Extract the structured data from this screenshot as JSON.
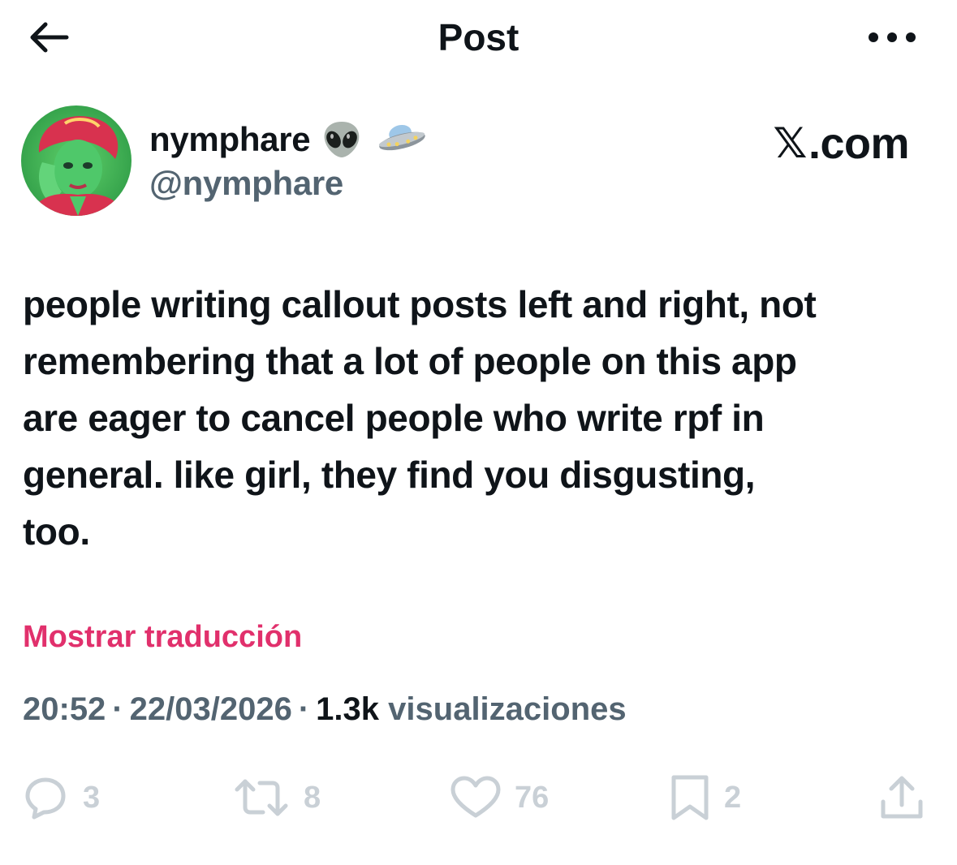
{
  "header": {
    "title": "Post",
    "back_icon": "arrow-left-icon",
    "more_icon": "more-horizontal-icon"
  },
  "author": {
    "display_name": "nymphare",
    "handle": "@nymphare",
    "emojis": [
      "alien-emoji",
      "ufo-emoji"
    ]
  },
  "watermark": {
    "x_glyph": "𝕏",
    "text": ".com"
  },
  "tweet": {
    "text": "people writing callout posts left and right, not\nremembering that a lot of people on this app\nare eager to cancel people who write rpf in\ngeneral. like girl, they find you disgusting,\ntoo."
  },
  "translate_label": "Mostrar traducción",
  "meta": {
    "time": "20:52",
    "separator": "·",
    "date": "22/03/2026",
    "views_count": "1.3k",
    "views_label": "visualizaciones"
  },
  "actions": {
    "replies": "3",
    "reposts": "8",
    "likes": "76",
    "bookmarks": "2"
  },
  "colors": {
    "text": "#0f1419",
    "secondary": "#536471",
    "accent_pink": "#e1306c",
    "action_gray": "#c9d0d6"
  }
}
